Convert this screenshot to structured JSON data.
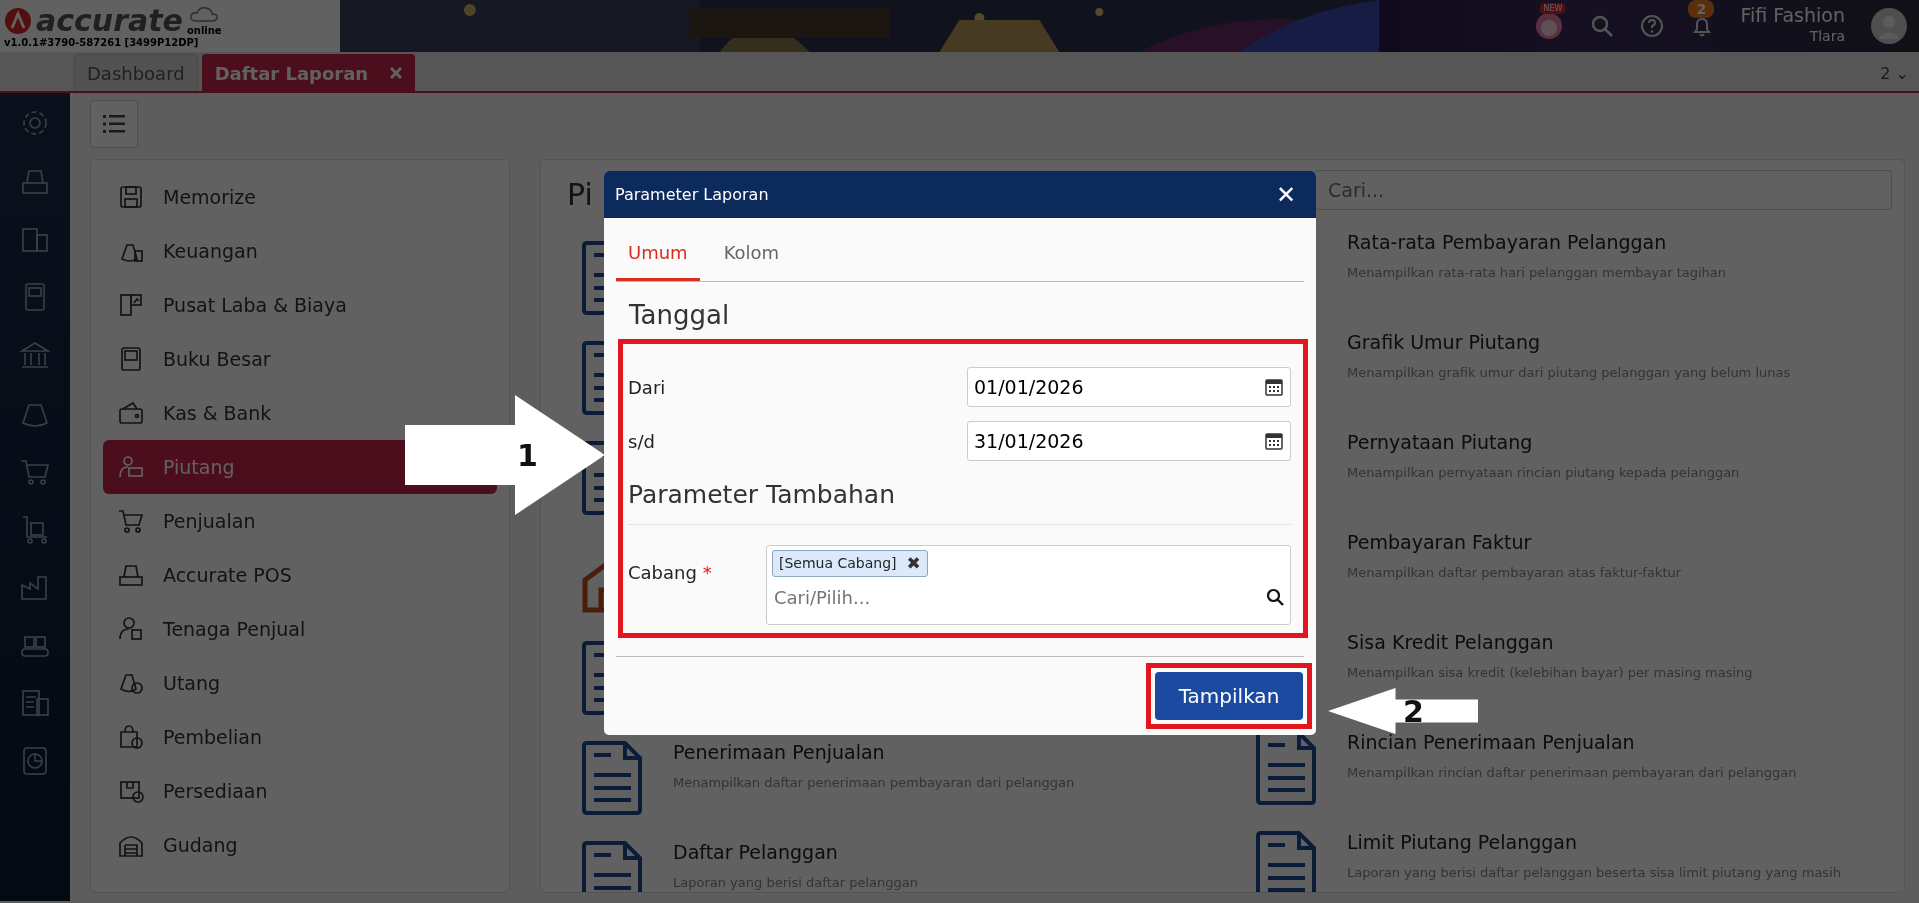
{
  "header": {
    "logo_text": "accurate",
    "logo_sub": "online",
    "version": "v1.0.1#3790-587261 [3499P12DP]",
    "new_badge": "NEW",
    "notification_count": "2",
    "user_name": "Fifi Fashion",
    "user_sub": "Tlara"
  },
  "tabs": [
    {
      "label": "Dashboard",
      "selected": false,
      "closable": false
    },
    {
      "label": "Daftar Laporan",
      "selected": true,
      "closable": true
    }
  ],
  "tab_counter": "2 ⌄",
  "menu": [
    {
      "label": "Memorize",
      "selected": false
    },
    {
      "label": "Keuangan",
      "selected": false
    },
    {
      "label": "Pusat Laba & Biaya",
      "selected": false
    },
    {
      "label": "Buku Besar",
      "selected": false
    },
    {
      "label": "Kas & Bank",
      "selected": false
    },
    {
      "label": "Piutang",
      "selected": true
    },
    {
      "label": "Penjualan",
      "selected": false
    },
    {
      "label": "Accurate POS",
      "selected": false
    },
    {
      "label": "Tenaga Penjual",
      "selected": false
    },
    {
      "label": "Utang",
      "selected": false
    },
    {
      "label": "Pembelian",
      "selected": false
    },
    {
      "label": "Persediaan",
      "selected": false
    },
    {
      "label": "Gudang",
      "selected": false
    }
  ],
  "reports": {
    "heading": "Pi",
    "search_placeholder": "Cari...",
    "column_1": [
      {
        "kind": "report"
      },
      {
        "kind": "report"
      },
      {
        "kind": "report"
      },
      {
        "kind": "section"
      },
      {
        "kind": "report"
      },
      {
        "kind": "report",
        "title": "Penerimaan Penjualan",
        "description": "Menampilkan daftar penerimaan pembayaran dari pelanggan"
      },
      {
        "kind": "report",
        "title": "Daftar Pelanggan",
        "description": "Laporan yang berisi daftar pelanggan"
      }
    ],
    "column_2": [
      {
        "kind": "covered",
        "title": "Rata-rata Pembayaran Pelanggan",
        "description": "Menampilkan rata-rata hari pelanggan membayar tagihan"
      },
      {
        "kind": "covered",
        "title": "Grafik Umur Piutang",
        "description": "Menampilkan grafik umur dari piutang pelanggan yang belum lunas"
      },
      {
        "kind": "covered",
        "title": "Pernyataan Piutang",
        "description": "Menampilkan pernyataan rincian piutang kepada pelanggan"
      },
      {
        "kind": "covered",
        "title": "Pembayaran Faktur",
        "description": "Menampilkan daftar pembayaran atas faktur-faktur"
      },
      {
        "kind": "covered",
        "title": "Sisa Kredit Pelanggan",
        "description": "Menampilkan sisa kredit (kelebihan bayar) per masing masing"
      },
      {
        "kind": "report",
        "title": "Rincian Penerimaan Penjualan",
        "description": "Menampilkan rincian daftar penerimaan pembayaran dari pelanggan"
      },
      {
        "kind": "report",
        "title": "Limit Piutang Pelanggan",
        "description": "Laporan yang berisi daftar pelanggan beserta sisa limit piutang yang masih"
      }
    ]
  },
  "dialog": {
    "title": "Parameter Laporan",
    "close_label": "✕",
    "tabs": [
      {
        "label": "Umum",
        "selected": true
      },
      {
        "label": "Kolom",
        "selected": false
      }
    ],
    "section_1": "Tanggal",
    "date_fields": [
      {
        "label": "Dari",
        "value": "01/01/2026"
      },
      {
        "label": "s/d",
        "value": "31/01/2026"
      }
    ],
    "section_2": "Parameter Tambahan",
    "branch": {
      "label": "Cabang",
      "required_mark": "*",
      "tags": [
        {
          "label": "[Semua Cabang]",
          "remove": "✖"
        }
      ],
      "placeholder": "Cari/Pilih..."
    },
    "submit": "Tampilkan"
  },
  "annotations": [
    {
      "label": "1",
      "kind": "right"
    },
    {
      "label": "2",
      "kind": "left"
    }
  ]
}
